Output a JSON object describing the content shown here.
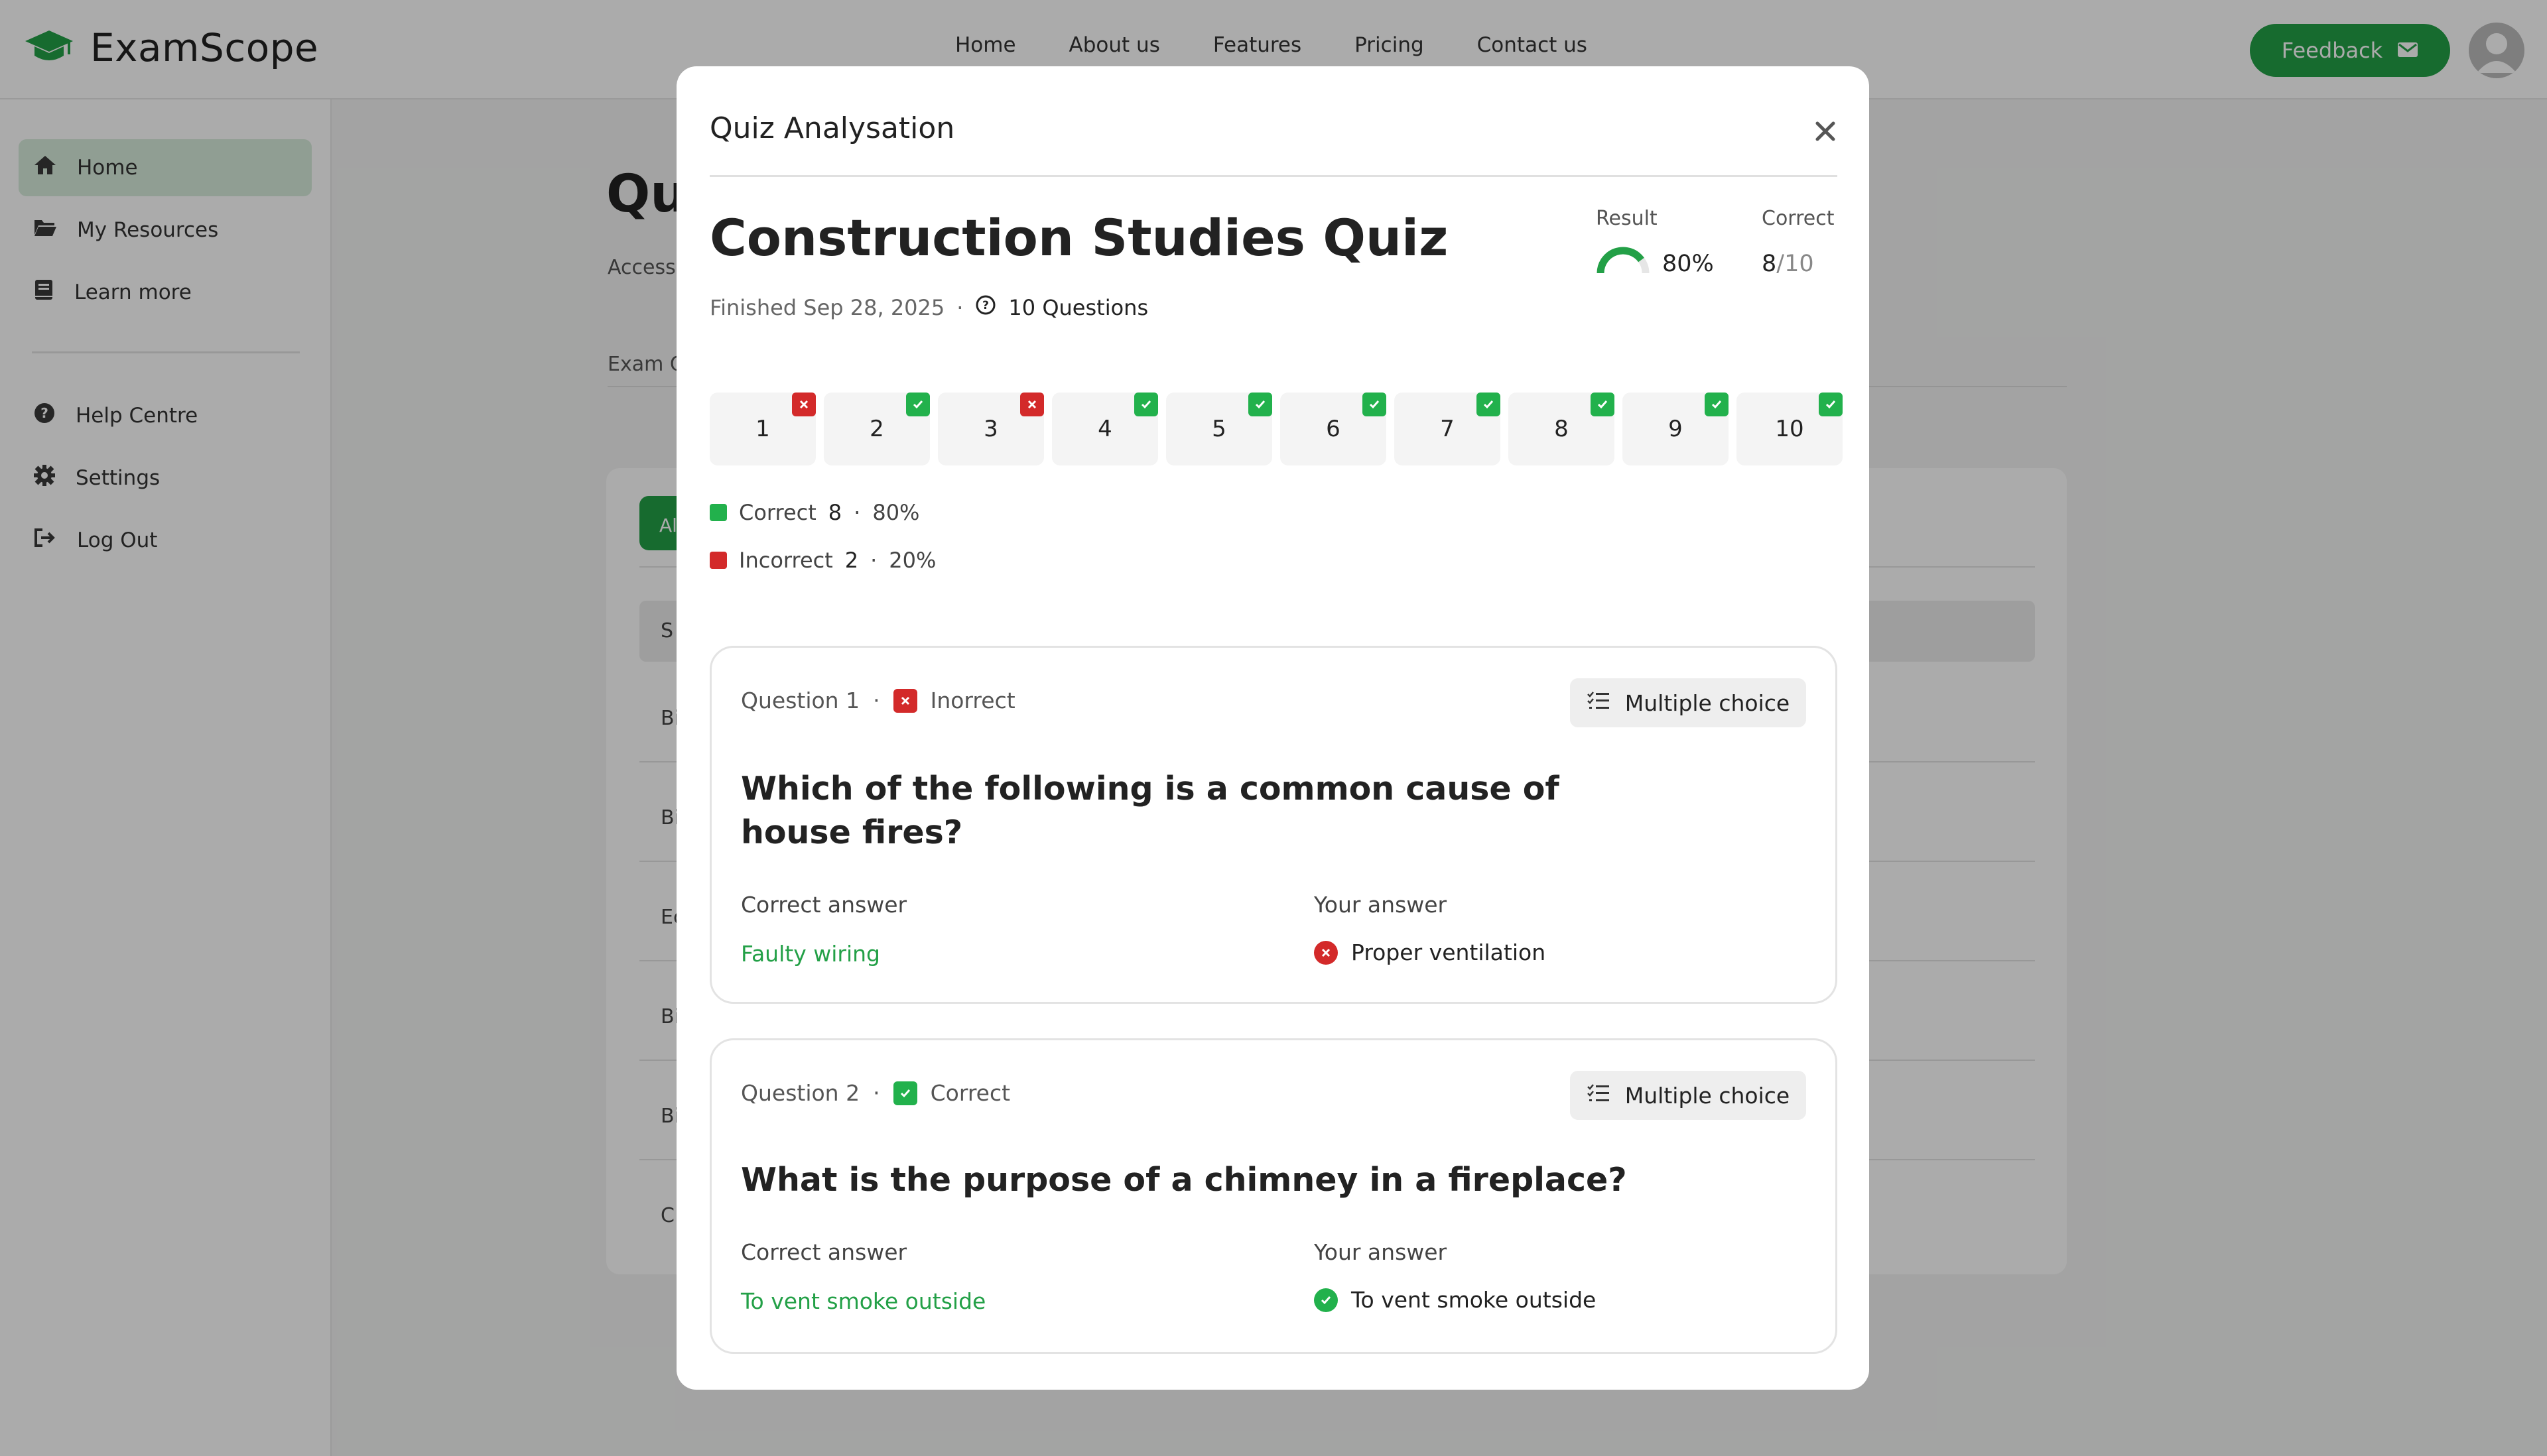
{
  "app": {
    "name": "ExamScope"
  },
  "nav": {
    "items": [
      "Home",
      "About us",
      "Features",
      "Pricing",
      "Contact us"
    ],
    "feedback_label": "Feedback"
  },
  "sidebar": {
    "items": [
      {
        "label": "Home",
        "icon": "home-icon",
        "active": true
      },
      {
        "label": "My Resources",
        "icon": "folder-icon"
      },
      {
        "label": "Learn more",
        "icon": "book-icon"
      },
      {
        "label": "Help Centre",
        "icon": "help-icon"
      },
      {
        "label": "Settings",
        "icon": "gear-icon"
      },
      {
        "label": "Log Out",
        "icon": "logout-icon"
      }
    ]
  },
  "background": {
    "title_partial": "Qu",
    "subtitle_partial": "Access",
    "label_partial": "Exam C",
    "pill_partial": "Al",
    "head_partial": "S",
    "rows_partial": [
      "Bi",
      "Bi",
      "Ec",
      "Bi",
      "Bi",
      "C"
    ]
  },
  "modal": {
    "title": "Quiz Analysation",
    "quiz_name": "Construction Studies Quiz",
    "finished": "Finished Sep 28, 2025",
    "question_count": "10 Questions",
    "result_label": "Result",
    "result_value": "80%",
    "result_fraction": 0.8,
    "correct_label": "Correct",
    "correct_value": "8",
    "correct_total": "/10",
    "questions": [
      {
        "n": "1",
        "status": "incorrect"
      },
      {
        "n": "2",
        "status": "correct"
      },
      {
        "n": "3",
        "status": "incorrect"
      },
      {
        "n": "4",
        "status": "correct"
      },
      {
        "n": "5",
        "status": "correct"
      },
      {
        "n": "6",
        "status": "correct"
      },
      {
        "n": "7",
        "status": "correct"
      },
      {
        "n": "8",
        "status": "correct"
      },
      {
        "n": "9",
        "status": "correct"
      },
      {
        "n": "10",
        "status": "correct"
      }
    ],
    "legend": {
      "correct_label": "Correct",
      "correct_count": "8",
      "correct_pct": "80%",
      "incorrect_label": "Incorrect",
      "incorrect_count": "2",
      "incorrect_pct": "20%"
    },
    "cards": [
      {
        "number": "Question 1",
        "status": "Inorrect",
        "type": "Multiple choice",
        "question": "Which of the following is a common cause of house fires?",
        "correct_label": "Correct answer",
        "correct_answer": "Faulty wiring",
        "your_label": "Your answer",
        "your_answer": "Proper ventilation"
      },
      {
        "number": "Question 2",
        "status": "Correct",
        "type": "Multiple choice",
        "question": "What is the purpose of a chimney in a fireplace?",
        "correct_label": "Correct answer",
        "correct_answer": "To vent smoke outside",
        "your_label": "Your answer",
        "your_answer": "To vent smoke outside"
      }
    ]
  },
  "colors": {
    "accent": "#23a047",
    "correct": "#22b14c",
    "incorrect": "#d32a2a"
  }
}
